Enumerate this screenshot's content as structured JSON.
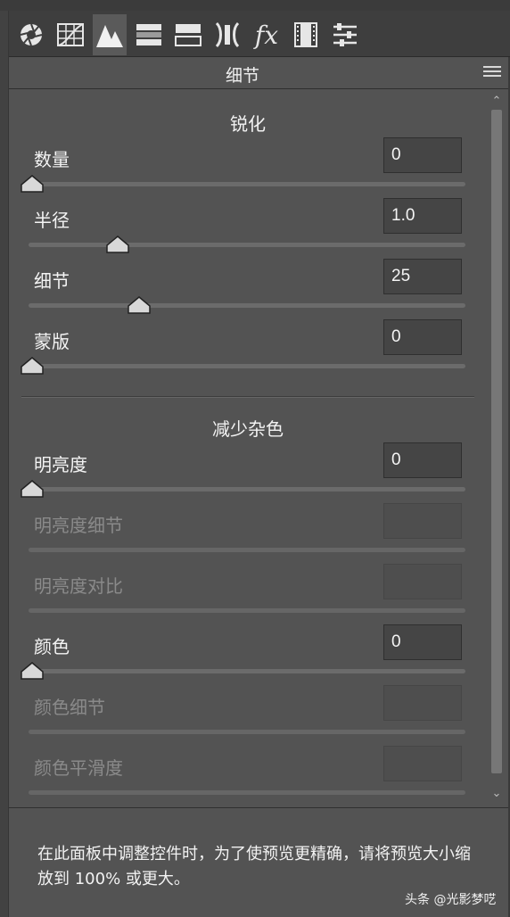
{
  "toolbar": {
    "tools": [
      {
        "icon": "aperture-icon",
        "active": false
      },
      {
        "icon": "tone-curve-icon",
        "active": false
      },
      {
        "icon": "detail-icon",
        "active": true
      },
      {
        "icon": "hsl-icon",
        "active": false
      },
      {
        "icon": "split-toning-icon",
        "active": false
      },
      {
        "icon": "lens-corrections-icon",
        "active": false
      },
      {
        "icon": "fx-icon",
        "active": false,
        "text": "fx"
      },
      {
        "icon": "calibration-icon",
        "active": false
      },
      {
        "icon": "presets-icon",
        "active": false
      }
    ]
  },
  "panel": {
    "title": "细节",
    "menu_icon": "menu-lines-icon"
  },
  "sharpening": {
    "title": "锐化",
    "rows": [
      {
        "label": "数量",
        "value": "0",
        "level": 0.0,
        "enabled": true
      },
      {
        "label": "半径",
        "value": "1.0",
        "level": 0.2,
        "enabled": true
      },
      {
        "label": "细节",
        "value": "25",
        "level": 0.25,
        "enabled": true
      },
      {
        "label": "蒙版",
        "value": "0",
        "level": 0.0,
        "enabled": true
      }
    ]
  },
  "noise": {
    "title": "减少杂色",
    "rows": [
      {
        "label": "明亮度",
        "value": "0",
        "level": 0.0,
        "enabled": true
      },
      {
        "label": "明亮度细节",
        "value": "",
        "enabled": false
      },
      {
        "label": "明亮度对比",
        "value": "",
        "enabled": false
      },
      {
        "label": "颜色",
        "value": "0",
        "level": 0.0,
        "enabled": true
      },
      {
        "label": "颜色细节",
        "value": "",
        "enabled": false
      },
      {
        "label": "颜色平滑度",
        "value": "",
        "enabled": false
      }
    ]
  },
  "footer": {
    "hint": "在此面板中调整控件时，为了使预览更精确，请将预览大小缩放到 100% 或更大。",
    "watermark": "头条 @光影梦呓"
  }
}
